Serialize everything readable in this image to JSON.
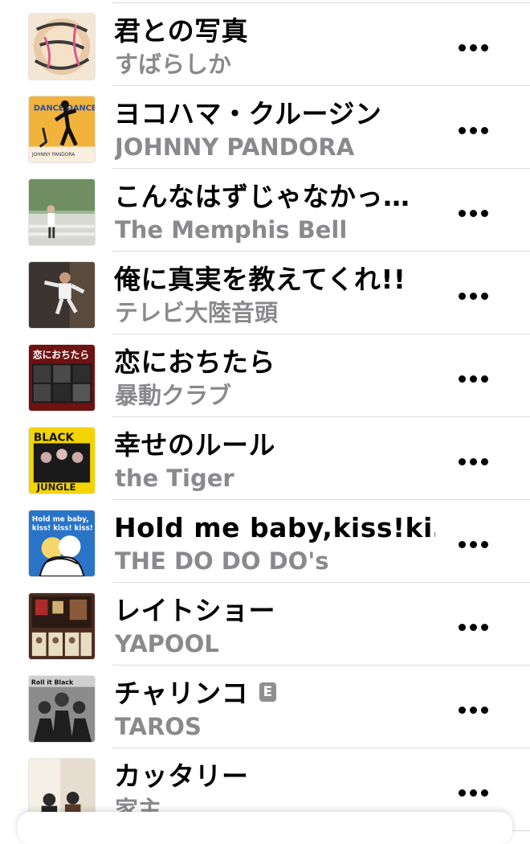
{
  "songs": [
    {
      "title": "君との写真",
      "artist": "すばらしか",
      "explicit": false,
      "art_icon": "album-art-subarashika"
    },
    {
      "title": "ヨコハマ・クルージン",
      "artist": "JOHNNY PANDORA",
      "explicit": false,
      "art_icon": "album-art-johnny-pandora"
    },
    {
      "title": "こんなはずじゃなかっ…",
      "artist": "The Memphis Bell",
      "explicit": false,
      "art_icon": "album-art-memphis-bell"
    },
    {
      "title": "俺に真実を教えてくれ!!",
      "artist": "テレビ大陸音頭",
      "explicit": false,
      "art_icon": "album-art-terebi-tairiku"
    },
    {
      "title": "恋におちたら",
      "artist": "暴動クラブ",
      "explicit": false,
      "art_icon": "album-art-boudou-club"
    },
    {
      "title": "幸せのルール",
      "artist": "the Tiger",
      "explicit": false,
      "art_icon": "album-art-the-tiger"
    },
    {
      "title": "Hold me baby,kiss!ki…",
      "artist": "THE DO DO DO's",
      "explicit": false,
      "art_icon": "album-art-do-do-dos"
    },
    {
      "title": "レイトショー",
      "artist": "YAPOOL",
      "explicit": false,
      "art_icon": "album-art-yapool"
    },
    {
      "title": "チャリンコ",
      "artist": "TAROS",
      "explicit": true,
      "explicit_label": "E",
      "art_icon": "album-art-taros"
    },
    {
      "title": "カッタリー",
      "artist": "家主",
      "explicit": false,
      "art_icon": "album-art-yanushi"
    }
  ],
  "art_texts": {
    "johnny": "DANCE DANCE DANCE",
    "johnny_footer": "JOHNNY PANDORA",
    "boudou": "恋におちたら",
    "tiger_top": "BLACK",
    "tiger_bottom": "JUNGLE",
    "dodo_line1": "Hold me baby,",
    "dodo_line2": "kiss! kiss! kiss!",
    "taros": "Roll it Black"
  },
  "colors": {
    "artist_gray": "#8a8a8e",
    "separator": "#dcdcdc",
    "explicit_badge": "#8e8e93"
  },
  "more_icon": "ellipsis-more-icon"
}
